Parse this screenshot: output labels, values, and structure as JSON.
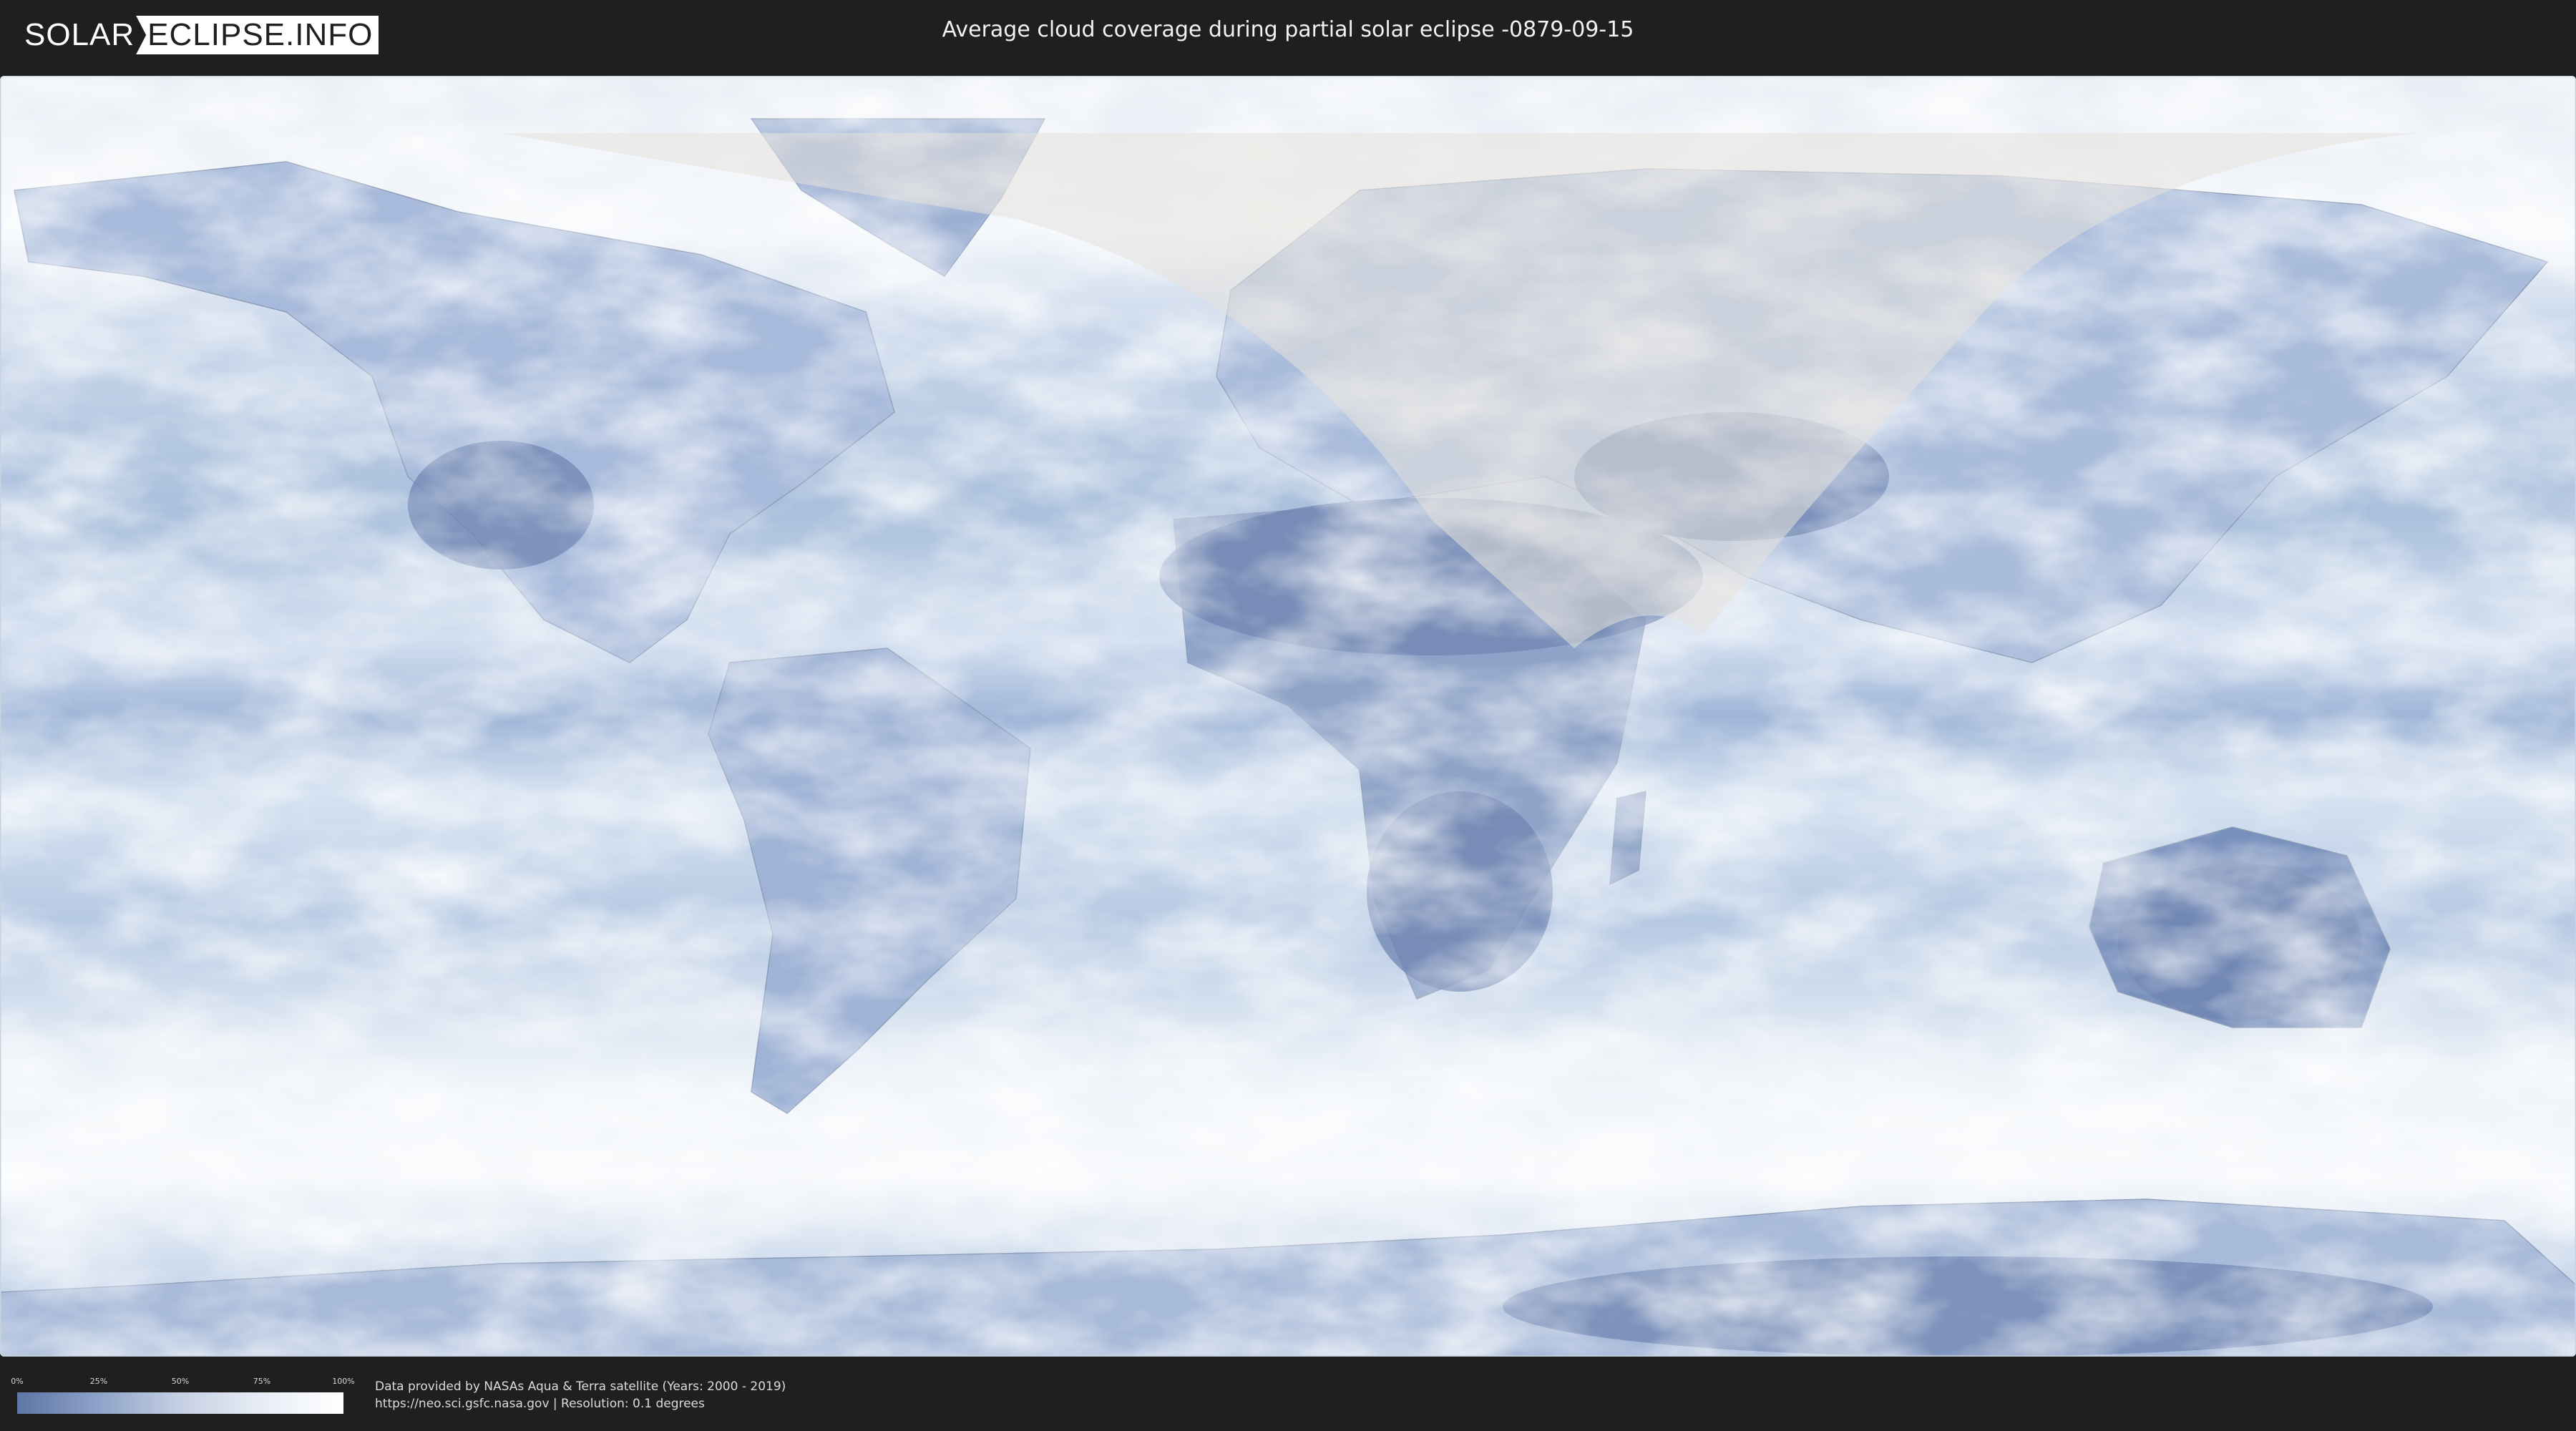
{
  "header": {
    "logo_left": "SOLAR",
    "logo_right": "ECLIPSE.INFO",
    "title": "Average cloud coverage during partial solar eclipse -0879-09-15"
  },
  "map": {
    "description_layer": "cloud-coverage",
    "colors": {
      "ocean_clear": "#cfdced",
      "cloud": "#ffffff",
      "land_clear": "#5e76a6",
      "eclipse_overlay": "#e6e1dc"
    }
  },
  "legend": {
    "ticks": [
      "0%",
      "25%",
      "50%",
      "75%",
      "100%"
    ],
    "colors": [
      "#5e76a6",
      "#8ea3c8",
      "#c5d0e3",
      "#e8edf5",
      "#ffffff"
    ]
  },
  "credits": {
    "line1": "Data provided by NASAs Aqua & Terra satellite (Years: 2000 - 2019)",
    "line2": "https://neo.sci.gsfc.nasa.gov | Resolution: 0.1 degrees"
  }
}
